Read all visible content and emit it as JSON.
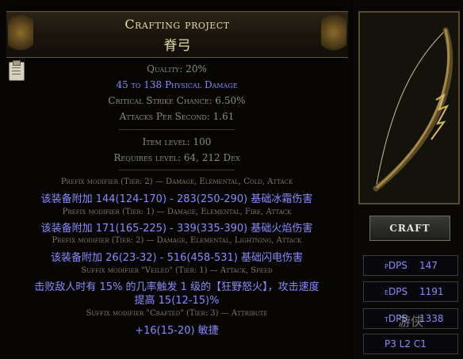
{
  "header": {
    "title": "Crafting project",
    "subtitle": "脊弓"
  },
  "properties": {
    "quality": "Quality: 20%",
    "physical_damage": "45 to 138 Physical Damage",
    "crit_chance": "Critical Strike Chance: 6.50%",
    "attacks_per_second": "Attacks Per Second: 1.61"
  },
  "requirements": {
    "item_level": "Item level: 100",
    "requires_level": "Requires level: 64, 212 Dex"
  },
  "modifiers": [
    {
      "header": "Prefix modifier (Tier: 2) — Damage, Elemental, Cold, Attack",
      "text": "该装备附加 144(124-170) - 283(250-290) 基础冰霜伤害"
    },
    {
      "header": "Prefix modifier (Tier: 1) — Damage, Elemental, Fire, Attack",
      "text": "该装备附加 171(165-225) - 339(335-390) 基础火焰伤害"
    },
    {
      "header": "Prefix modifier (Tier: 2) — Damage, Elemental, Lightning, Attack",
      "text": "该装备附加 26(23-32) - 516(458-531) 基础闪电伤害"
    },
    {
      "header": "Suffix modifier \"Veiled\" (Tier: 1) — Attack, Speed",
      "text": "击败敌人时有 15% 的几率触发 1 级的【狂野怒火】，攻击速度",
      "text2": "提高 15(12-15)%"
    },
    {
      "header": "Suffix modifier \"Crafted\" (Tier: 3) — Attribute",
      "text": "+16(15-20) 敏捷"
    }
  ],
  "sidebar": {
    "craft_label": "Craft",
    "stats": [
      {
        "label": "pDPS",
        "value": "147"
      },
      {
        "label": "eDPS",
        "value": "1191"
      },
      {
        "label": "tDPS",
        "value": "1338"
      }
    ],
    "sockets_text": "P3 L2 C1",
    "watermark": "游侠"
  },
  "colors": {
    "magic_text": "#8a8aff",
    "header_gold": "#e8d8a8",
    "label_gray": "#8c8c84"
  }
}
